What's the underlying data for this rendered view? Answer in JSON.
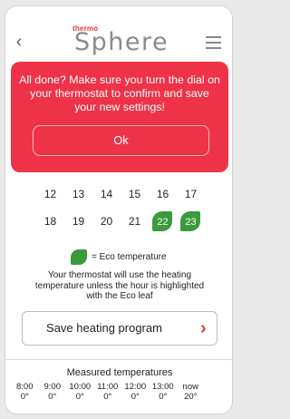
{
  "header": {
    "back_icon": "chevron-left-icon",
    "back_glyph": "‹",
    "logo_top": "thermo",
    "logo_main": "Sphere",
    "menu_icon": "hamburger-menu-icon"
  },
  "alert": {
    "message": "All done? Make sure you turn the dial on your thermostat to confirm and save your new settings!",
    "ok_label": "Ok",
    "color": "#ee3348"
  },
  "days": {
    "row1": [
      {
        "label": "12",
        "eco": false
      },
      {
        "label": "13",
        "eco": false
      },
      {
        "label": "14",
        "eco": false
      },
      {
        "label": "15",
        "eco": false
      },
      {
        "label": "16",
        "eco": false
      },
      {
        "label": "17",
        "eco": false
      }
    ],
    "row2": [
      {
        "label": "18",
        "eco": false
      },
      {
        "label": "19",
        "eco": false
      },
      {
        "label": "20",
        "eco": false
      },
      {
        "label": "21",
        "eco": false
      },
      {
        "label": "22",
        "eco": true
      },
      {
        "label": "23",
        "eco": true
      }
    ],
    "eco_color": "#3b9a3a"
  },
  "legend": {
    "icon": "eco-leaf-icon",
    "text": "= Eco temperature"
  },
  "info": {
    "text": "Your thermostat will use the heating temperature unless the hour is highlighted with the Eco leaf"
  },
  "save": {
    "label": "Save heating program",
    "chevron": "›",
    "chevron_icon": "chevron-right-icon",
    "accent": "#e8333f"
  },
  "measured": {
    "title": "Measured temperatures",
    "items": [
      {
        "time": "8:00",
        "temp": "0°"
      },
      {
        "time": "9:00",
        "temp": "0°"
      },
      {
        "time": "10:00",
        "temp": "0°"
      },
      {
        "time": "11:00",
        "temp": "0°"
      },
      {
        "time": "12:00",
        "temp": "0°"
      },
      {
        "time": "13:00",
        "temp": "0°"
      },
      {
        "time": "now",
        "temp": "20°"
      }
    ]
  }
}
